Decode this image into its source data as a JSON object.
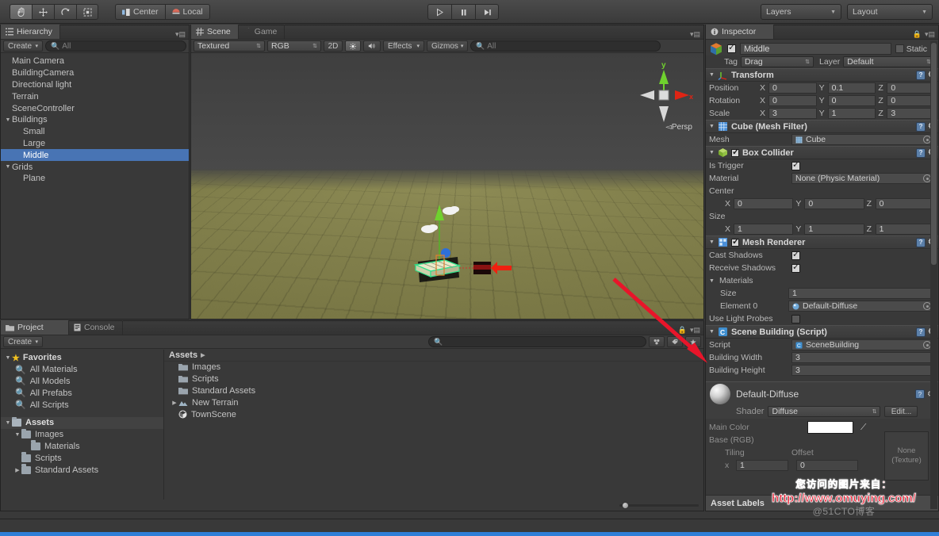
{
  "toolbar": {
    "tools": [
      {
        "name": "hand-tool",
        "glyph": "✋",
        "active": true
      },
      {
        "name": "move-tool",
        "glyph": "✥",
        "active": false
      },
      {
        "name": "rotate-tool",
        "glyph": "⟳",
        "active": false
      },
      {
        "name": "scale-tool",
        "glyph": "⤢",
        "active": false
      }
    ],
    "pivot_label": "Center",
    "space_label": "Local",
    "play_label": "▶",
    "pause_label": "❙❙",
    "step_label": "▶❙",
    "layers_label": "Layers",
    "layout_label": "Layout"
  },
  "hierarchy": {
    "tab_label": "Hierarchy",
    "create_label": "Create",
    "search_placeholder": "All",
    "items": [
      {
        "label": "Main Camera",
        "depth": 1,
        "expandable": false,
        "selected": false
      },
      {
        "label": "BuildingCamera",
        "depth": 1,
        "expandable": false,
        "selected": false
      },
      {
        "label": "Directional light",
        "depth": 1,
        "expandable": false,
        "selected": false
      },
      {
        "label": "Terrain",
        "depth": 1,
        "expandable": false,
        "selected": false
      },
      {
        "label": "SceneController",
        "depth": 1,
        "expandable": false,
        "selected": false
      },
      {
        "label": "Buildings",
        "depth": 0,
        "expandable": true,
        "expanded": true,
        "selected": false
      },
      {
        "label": "Small",
        "depth": 2,
        "expandable": false,
        "selected": false
      },
      {
        "label": "Large",
        "depth": 2,
        "expandable": false,
        "selected": false
      },
      {
        "label": "Middle",
        "depth": 2,
        "expandable": false,
        "selected": true
      },
      {
        "label": "Grids",
        "depth": 0,
        "expandable": true,
        "expanded": true,
        "selected": false
      },
      {
        "label": "Plane",
        "depth": 2,
        "expandable": false,
        "selected": false
      }
    ]
  },
  "scene": {
    "tabs": [
      {
        "label": "Scene",
        "active": true,
        "icon": "grid-icon"
      },
      {
        "label": "Game",
        "active": false,
        "icon": "gamepad-icon"
      }
    ],
    "draw_mode": "Textured",
    "color_mode": "RGB",
    "toggle_2d": "2D",
    "light_icon": "sun-icon",
    "audio_icon": "audio-icon",
    "effects_label": "Effects",
    "gizmos_label": "Gizmos",
    "search_placeholder": "All",
    "gizmo": {
      "y_label": "y",
      "x_label": "x",
      "projection": "Persp"
    }
  },
  "inspector": {
    "tab_label": "Inspector",
    "object_name": "Middle",
    "enabled": true,
    "static_label": "Static",
    "tag_label": "Tag",
    "tag_value": "Drag",
    "layer_label": "Layer",
    "layer_value": "Default",
    "components": [
      {
        "name": "transform",
        "title": "Transform",
        "icon_color": "#7fc23c",
        "rows": [
          {
            "label": "Position",
            "x": "0",
            "y": "0.1",
            "z": "0"
          },
          {
            "label": "Rotation",
            "x": "0",
            "y": "0",
            "z": "0"
          },
          {
            "label": "Scale",
            "x": "3",
            "y": "1",
            "z": "3"
          }
        ]
      },
      {
        "name": "mesh-filter",
        "title": "Cube (Mesh Filter)",
        "icon_color": "#5aa0dc",
        "mesh_label": "Mesh",
        "mesh_value": "Cube"
      },
      {
        "name": "box-collider",
        "title": "Box Collider",
        "icon_color": "#8cc63e",
        "enabled": true,
        "is_trigger_label": "Is Trigger",
        "is_trigger": true,
        "material_label": "Material",
        "material_value": "None (Physic Material)",
        "center_label": "Center",
        "center": {
          "x": "0",
          "y": "0",
          "z": "0"
        },
        "size_label": "Size",
        "size": {
          "x": "1",
          "y": "1",
          "z": "1"
        }
      },
      {
        "name": "mesh-renderer",
        "title": "Mesh Renderer",
        "icon_color": "#5aa0dc",
        "enabled": true,
        "cast_shadows_label": "Cast Shadows",
        "cast_shadows": true,
        "receive_shadows_label": "Receive Shadows",
        "receive_shadows": true,
        "materials_label": "Materials",
        "size_label": "Size",
        "size_value": "1",
        "element0_label": "Element 0",
        "element0_value": "Default-Diffuse",
        "light_probes_label": "Use Light Probes",
        "light_probes": false
      },
      {
        "name": "scene-building-script",
        "title": "Scene Building (Script)",
        "icon_color": "#3f8fd0",
        "script_label": "Script",
        "script_value": "SceneBuilding",
        "building_width_label": "Building Width",
        "building_width": "3",
        "building_height_label": "Building Height",
        "building_height": "3"
      }
    ],
    "material_preview": {
      "title": "Default-Diffuse",
      "shader_label": "Shader",
      "shader_value": "Diffuse",
      "edit_label": "Edit...",
      "main_color_label": "Main Color",
      "base_rgb_label": "Base (RGB)",
      "tiling_label": "Tiling",
      "offset_label": "Offset",
      "tiling_axis": "x",
      "tiling_value": "1",
      "offset_value": "0",
      "texture_none_line1": "None",
      "texture_none_line2": "(Texture)",
      "main_color_hex": "#ffffff"
    },
    "asset_labels_title": "Asset Labels"
  },
  "project": {
    "tabs": [
      {
        "label": "Project",
        "active": true,
        "icon": "folder-icon"
      },
      {
        "label": "Console",
        "active": false,
        "icon": "console-icon"
      }
    ],
    "create_label": "Create",
    "search_placeholder": "",
    "favorites_label": "Favorites",
    "favorites": [
      {
        "label": "All Materials"
      },
      {
        "label": "All Models"
      },
      {
        "label": "All Prefabs"
      },
      {
        "label": "All Scripts"
      }
    ],
    "assets_root_label": "Assets",
    "tree": [
      {
        "label": "Images",
        "depth": 1,
        "expandable": true,
        "expanded": true
      },
      {
        "label": "Materials",
        "depth": 2,
        "expandable": false
      },
      {
        "label": "Scripts",
        "depth": 1,
        "expandable": false
      },
      {
        "label": "Standard Assets",
        "depth": 1,
        "expandable": true,
        "expanded": false
      }
    ],
    "breadcrumb": "Assets",
    "contents": [
      {
        "label": "Images",
        "icon": "folder-icon",
        "expandable": false
      },
      {
        "label": "Scripts",
        "icon": "folder-icon",
        "expandable": false
      },
      {
        "label": "Standard Assets",
        "icon": "folder-icon",
        "expandable": false
      },
      {
        "label": "New Terrain",
        "icon": "terrain-icon",
        "expandable": true
      },
      {
        "label": "TownScene",
        "icon": "unity-scene-icon",
        "expandable": false
      }
    ]
  },
  "watermark": {
    "line_cn": "您访问的图片来自：",
    "line_url": "http://www.omuying.com/",
    "line_site": "@51CTO博客"
  },
  "colors": {
    "selection_blue": "#4874b4",
    "accent_blue": "#2f7fd8",
    "annotation_red": "#e8152a"
  }
}
